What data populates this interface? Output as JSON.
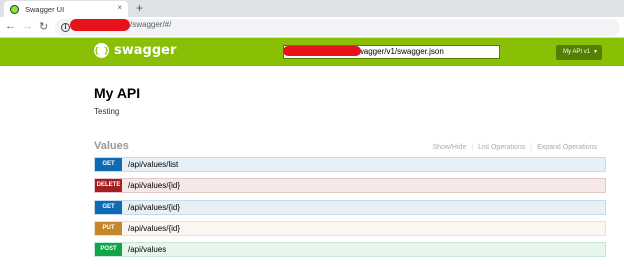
{
  "browser": {
    "tab_title": "Swagger UI",
    "tab_close": "×",
    "new_tab": "+",
    "url_visible": "/swagger/#/"
  },
  "header": {
    "logo_glyph": "{ }",
    "logo_text": "swagger",
    "spec_url_visible": "swagger/v1/swagger.json",
    "version_selected": "My API v1",
    "brand_color": "#89bf04"
  },
  "info": {
    "title": "My API",
    "description": "Testing"
  },
  "resource": {
    "name": "Values",
    "links": [
      "Show/Hide",
      "List Operations",
      "Expand Operations"
    ]
  },
  "operations": [
    {
      "method": "GET",
      "path": "/api/values/list",
      "color": "#0f6ab4"
    },
    {
      "method": "DELETE",
      "path": "/api/values/{id}",
      "color": "#a41e22"
    },
    {
      "method": "GET",
      "path": "/api/values/{id}",
      "color": "#0f6ab4"
    },
    {
      "method": "PUT",
      "path": "/api/values/{id}",
      "color": "#c5862b"
    },
    {
      "method": "POST",
      "path": "/api/values",
      "color": "#10a54a"
    }
  ]
}
